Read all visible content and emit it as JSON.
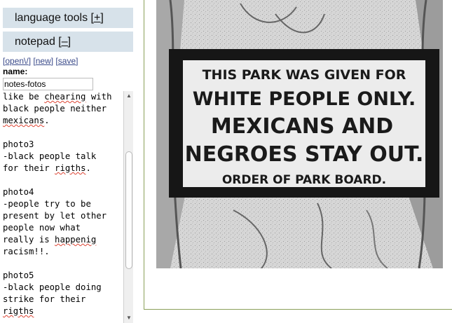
{
  "sidebar": {
    "language_tools": {
      "label": "language tools",
      "toggle": "[+]"
    },
    "notepad": {
      "label": "notepad",
      "toggle": "[–]"
    },
    "links": {
      "open": "open\\/",
      "new": "new",
      "save": "save"
    },
    "name_label": "name:",
    "name_value": "notes-fotos",
    "text_lines": [
      [
        "like be ",
        {
          "sp": "chearing"
        },
        " with"
      ],
      [
        "black people neither"
      ],
      [
        {
          "sp": "mexicans"
        },
        "."
      ],
      [
        ""
      ],
      [
        "photo3"
      ],
      [
        "-black people talk"
      ],
      [
        "for their ",
        {
          "sp": "rigths"
        },
        "."
      ],
      [
        ""
      ],
      [
        "photo4"
      ],
      [
        "-people try to be"
      ],
      [
        "present by let other"
      ],
      [
        "people now what"
      ],
      [
        "really is ",
        {
          "sp": "happenig"
        }
      ],
      [
        "racism!!."
      ],
      [
        ""
      ],
      [
        "photo5"
      ],
      [
        "-black people doing"
      ],
      [
        "strike for their"
      ],
      [
        {
          "sp": "rigths"
        }
      ]
    ]
  },
  "photo": {
    "sign_lines": [
      "THIS PARK WAS GIVEN FOR",
      "WHITE PEOPLE ONLY.",
      "MEXICANS  AND",
      "NEGROES STAY OUT.",
      "ORDER OF PARK BOARD."
    ]
  }
}
